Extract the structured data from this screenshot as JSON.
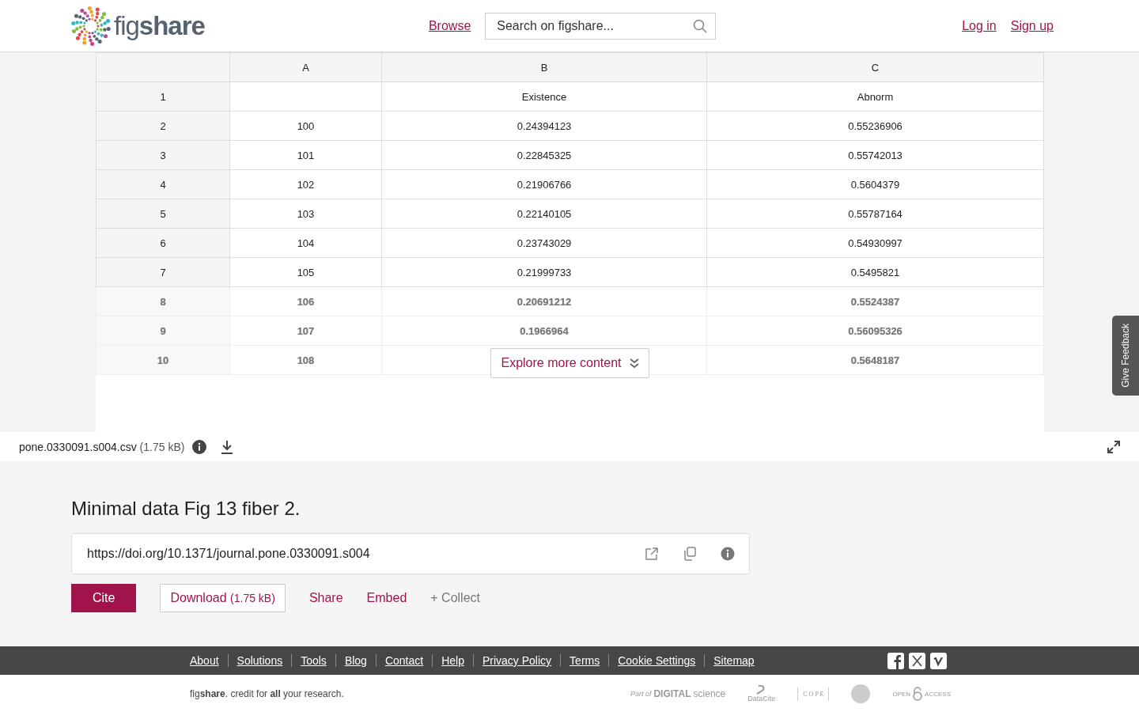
{
  "header": {
    "logo_text": "fig",
    "logo_bold": "share",
    "browse": "Browse",
    "search": {
      "placeholder": "Search on figshare..."
    },
    "login": "Log in",
    "signup": "Sign up"
  },
  "table": {
    "columns": [
      "A",
      "B",
      "C"
    ],
    "rows": [
      {
        "n": "1",
        "cells": [
          "",
          "Existence",
          "Abnorm"
        ],
        "blurred": false
      },
      {
        "n": "2",
        "cells": [
          "100",
          "0.24394123",
          "0.55236906"
        ],
        "blurred": false
      },
      {
        "n": "3",
        "cells": [
          "101",
          "0.22845325",
          "0.55742013"
        ],
        "blurred": false
      },
      {
        "n": "4",
        "cells": [
          "102",
          "0.21906766",
          "0.5604379"
        ],
        "blurred": false
      },
      {
        "n": "5",
        "cells": [
          "103",
          "0.22140105",
          "0.55787164"
        ],
        "blurred": false
      },
      {
        "n": "6",
        "cells": [
          "104",
          "0.23743029",
          "0.54930997"
        ],
        "blurred": false
      },
      {
        "n": "7",
        "cells": [
          "105",
          "0.21999733",
          "0.5495821"
        ],
        "blurred": false
      },
      {
        "n": "8",
        "cells": [
          "106",
          "0.20691212",
          "0.5524387"
        ],
        "blurred": true
      },
      {
        "n": "9",
        "cells": [
          "107",
          "0.1966964",
          "0.56095326"
        ],
        "blurred": true
      },
      {
        "n": "10",
        "cells": [
          "108",
          "",
          "0.5648187"
        ],
        "blurred": true
      }
    ],
    "explore_button": "Explore more content"
  },
  "feedback_tab": "Give Feedback",
  "file_bar": {
    "name": "pone.0330091.s004.csv",
    "size": "(1.75 kB)"
  },
  "item": {
    "title": "Minimal data Fig 13 fiber 2.",
    "doi": "https://doi.org/10.1371/journal.pone.0330091.s004",
    "actions": [
      {
        "kind": "primary",
        "label": "Cite"
      },
      {
        "kind": "outlined",
        "label": "Download",
        "extra": "(1.75 kB)"
      },
      {
        "kind": "link",
        "label": "Share"
      },
      {
        "kind": "link",
        "label": "Embed"
      },
      {
        "kind": "muted",
        "label": "+ Collect"
      }
    ]
  },
  "footer": {
    "links": [
      "About",
      "Solutions",
      "Tools",
      "Blog",
      "Contact",
      "Help",
      "Privacy Policy",
      "Terms",
      "Cookie Settings",
      "Sitemap"
    ],
    "tagline": "fig**share**. credit for **all** your research.",
    "partners": [
      {
        "kind": "digital-science",
        "prefix": "Part of",
        "name": "DIGITAL",
        "suffix": "science"
      },
      {
        "kind": "datacite",
        "name": "DataCite"
      },
      {
        "kind": "cope",
        "name": "C O P E"
      },
      {
        "kind": "seal"
      },
      {
        "kind": "open-access",
        "prefix": "OPEN",
        "name": "ACCESS"
      }
    ]
  }
}
